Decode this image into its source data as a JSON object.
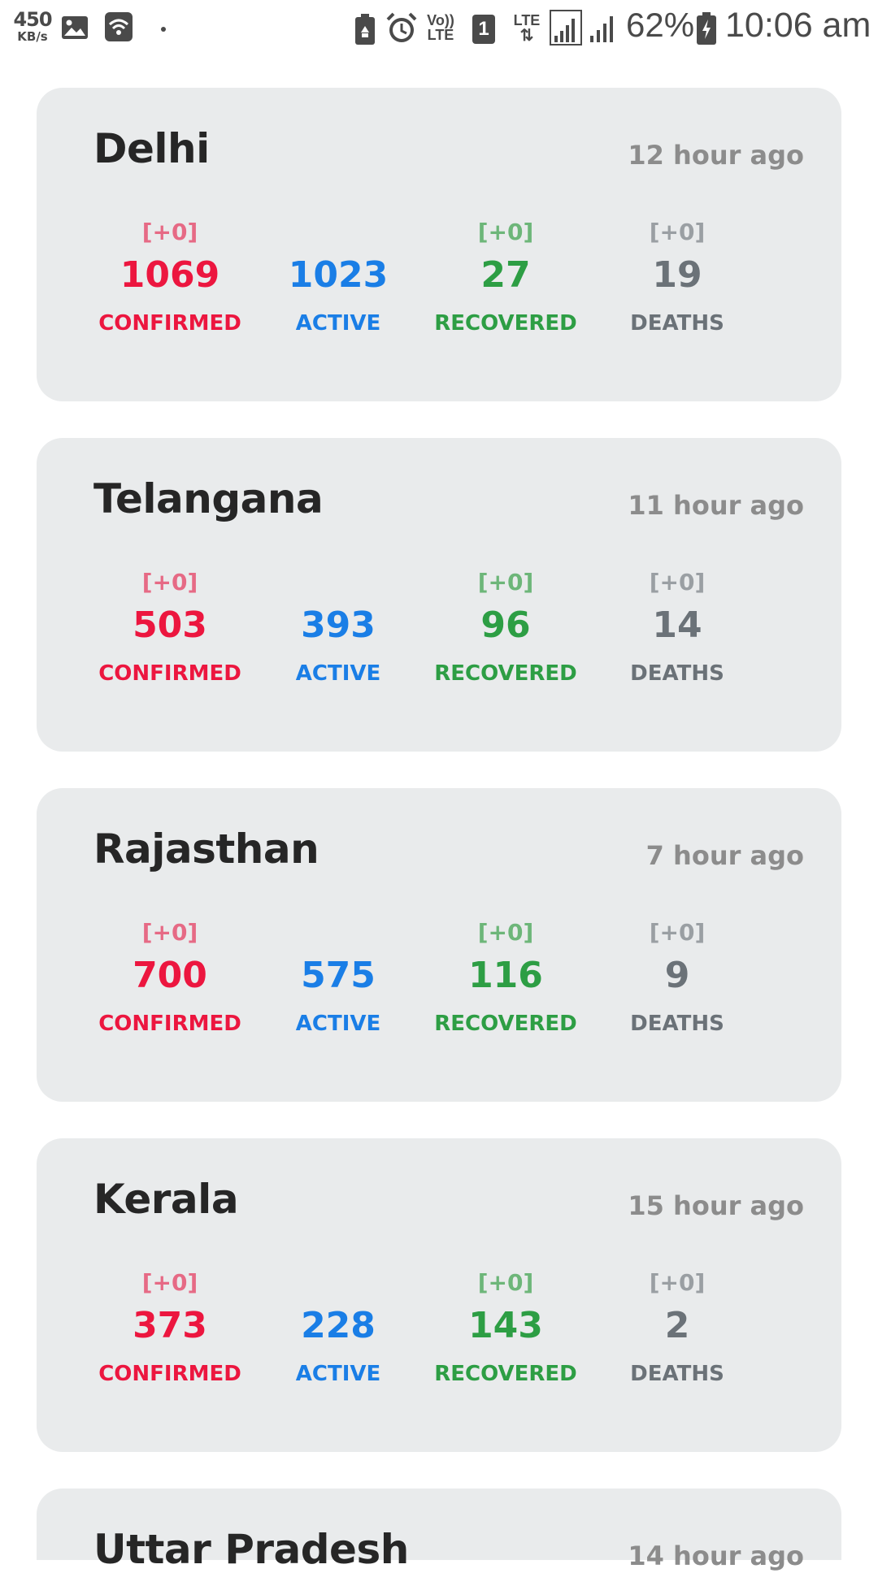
{
  "status_bar": {
    "net_speed": "450",
    "net_speed_unit": "KB/s",
    "volte": "Vo))",
    "volte_lte": "LTE",
    "sim_slot": "1",
    "lte": "LTE",
    "battery_percent": "62%",
    "time": "10:06 am",
    "icons": [
      "image-icon",
      "wifi-icon",
      "dot-icon",
      "battery-saver-icon",
      "alarm-icon",
      "volte-icon",
      "sim-icon",
      "lte-data-icon",
      "signal-icon",
      "signal-icon",
      "battery-icon"
    ]
  },
  "colors": {
    "confirmed": "#ec163f",
    "active": "#1a7ee6",
    "recovered": "#2d9e44",
    "deaths": "#6b7278",
    "card_bg": "#e9ebec"
  },
  "labels": {
    "confirmed": "CONFIRMED",
    "active": "ACTIVE",
    "recovered": "RECOVERED",
    "deaths": "DEATHS"
  },
  "states": [
    {
      "name": "Delhi",
      "updated": "12 hour ago",
      "confirmed": "1069",
      "confirmed_delta": "[+0]",
      "active": "1023",
      "recovered": "27",
      "recovered_delta": "[+0]",
      "deaths": "19",
      "deaths_delta": "[+0]"
    },
    {
      "name": "Telangana",
      "updated": "11 hour ago",
      "confirmed": "503",
      "confirmed_delta": "[+0]",
      "active": "393",
      "recovered": "96",
      "recovered_delta": "[+0]",
      "deaths": "14",
      "deaths_delta": "[+0]"
    },
    {
      "name": "Rajasthan",
      "updated": "7 hour ago",
      "confirmed": "700",
      "confirmed_delta": "[+0]",
      "active": "575",
      "recovered": "116",
      "recovered_delta": "[+0]",
      "deaths": "9",
      "deaths_delta": "[+0]"
    },
    {
      "name": "Kerala",
      "updated": "15 hour ago",
      "confirmed": "373",
      "confirmed_delta": "[+0]",
      "active": "228",
      "recovered": "143",
      "recovered_delta": "[+0]",
      "deaths": "2",
      "deaths_delta": "[+0]"
    },
    {
      "name": "Uttar Pradesh",
      "updated": "14 hour ago"
    }
  ]
}
